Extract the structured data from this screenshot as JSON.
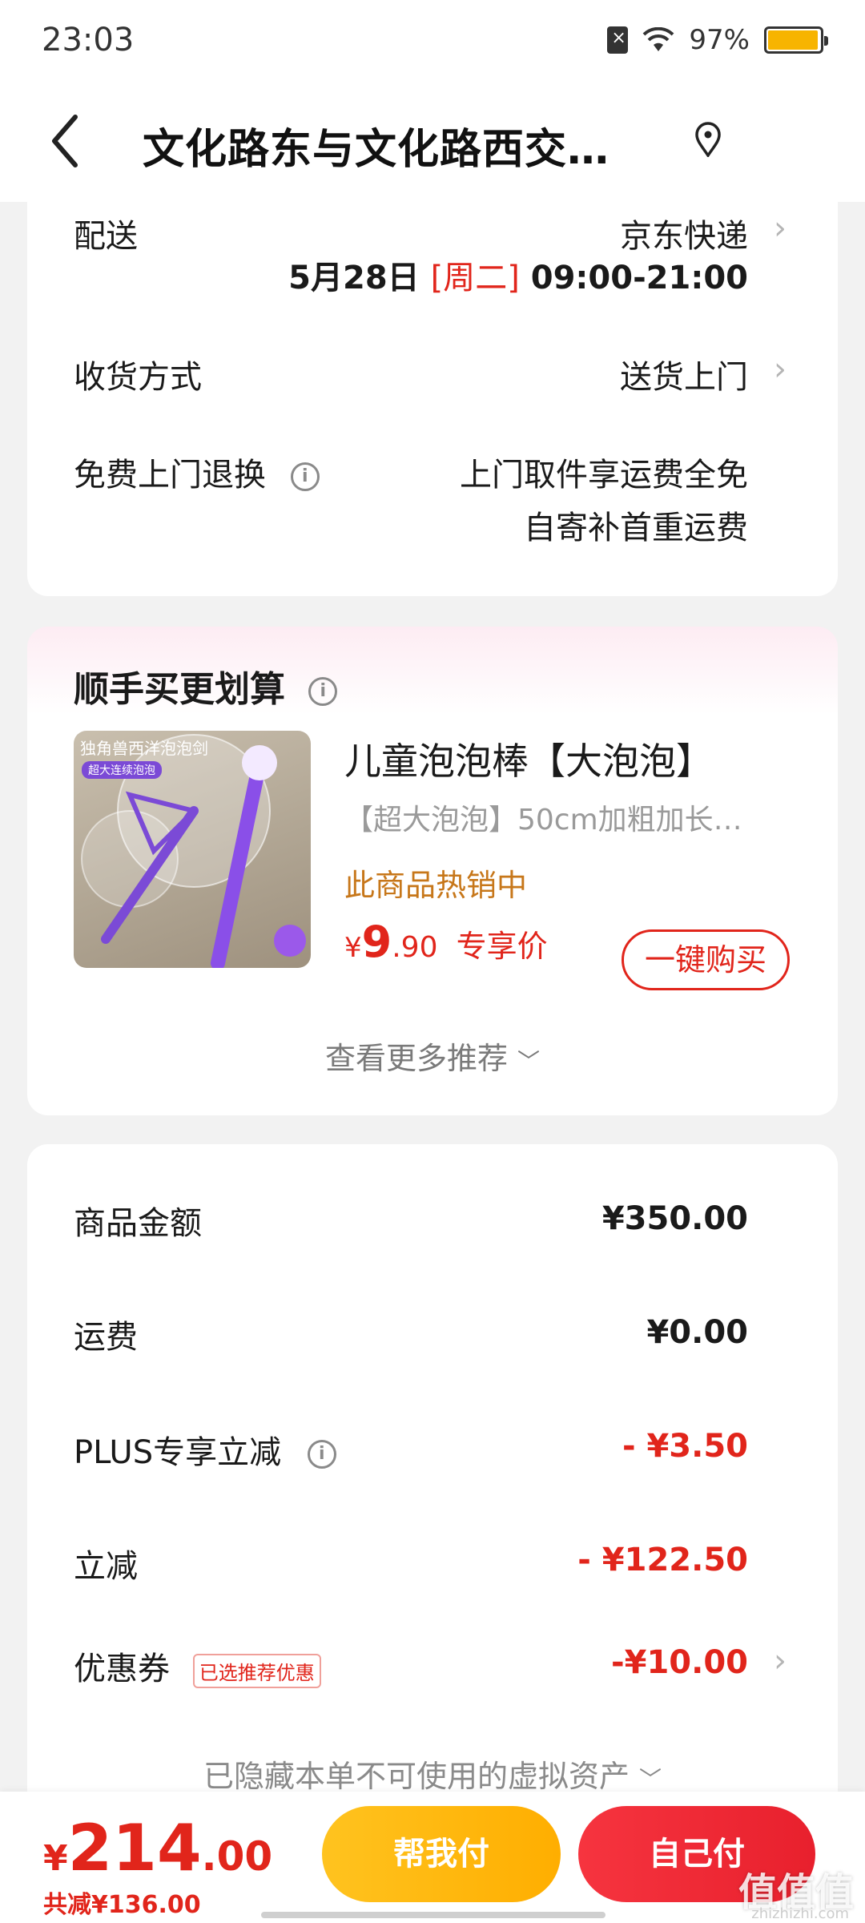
{
  "status_bar": {
    "time": "23:03",
    "battery_percent": "97%",
    "battery_level": 0.97,
    "battery_color": "#f7b400"
  },
  "header": {
    "back_icon": "chevron-left-icon",
    "title": "文化路东与文化路西交…",
    "location_icon": "location-pin-icon"
  },
  "delivery": {
    "label": "配送",
    "carrier": "京东快递",
    "date": "5月28日",
    "weekday": "[周二]",
    "time_window": "09:00-21:00",
    "receive_label": "收货方式",
    "receive_value": "送货上门",
    "return_label": "免费上门退换",
    "return_line1": "上门取件享运费全免",
    "return_line2": "自寄补首重运费"
  },
  "recommend": {
    "title": "顺手买更划算",
    "product": {
      "name": "儿童泡泡棒【大泡泡】",
      "desc": "【超大泡泡】50cm加粗加长…",
      "hot": "此商品热销中",
      "price_symbol": "¥",
      "price_int": "9",
      "price_dec": ".90",
      "price_tag": "专享价",
      "buy_label": "一键购买",
      "image_text_1": "独角兽西洋泡泡剑",
      "image_text_2": "超大连续泡泡"
    },
    "more_label": "查看更多推荐"
  },
  "summary": {
    "rows": [
      {
        "label": "商品金额",
        "value": "¥350.00"
      },
      {
        "label": "运费",
        "value": "¥0.00"
      },
      {
        "label": "PLUS专享立减",
        "value": "- ¥3.50"
      },
      {
        "label": "立减",
        "value": "- ¥122.50"
      },
      {
        "label": "优惠券",
        "value": "-¥10.00",
        "tag": "已选推荐优惠"
      }
    ],
    "hidden_assets": "已隐藏本单不可使用的虚拟资产"
  },
  "bottom": {
    "total_symbol": "¥",
    "total_int": "214",
    "total_dec": ".00",
    "saved": "共减¥136.00",
    "help_pay": "帮我付",
    "self_pay": "自己付"
  },
  "watermark": {
    "main": "值值值",
    "sub": "zhizhizhi.com"
  },
  "colors": {
    "accent_red": "#e1251b",
    "accent_orange": "#c7771a",
    "help_pay_yellow": "#ffb300",
    "self_pay_red": "#f02d38"
  }
}
